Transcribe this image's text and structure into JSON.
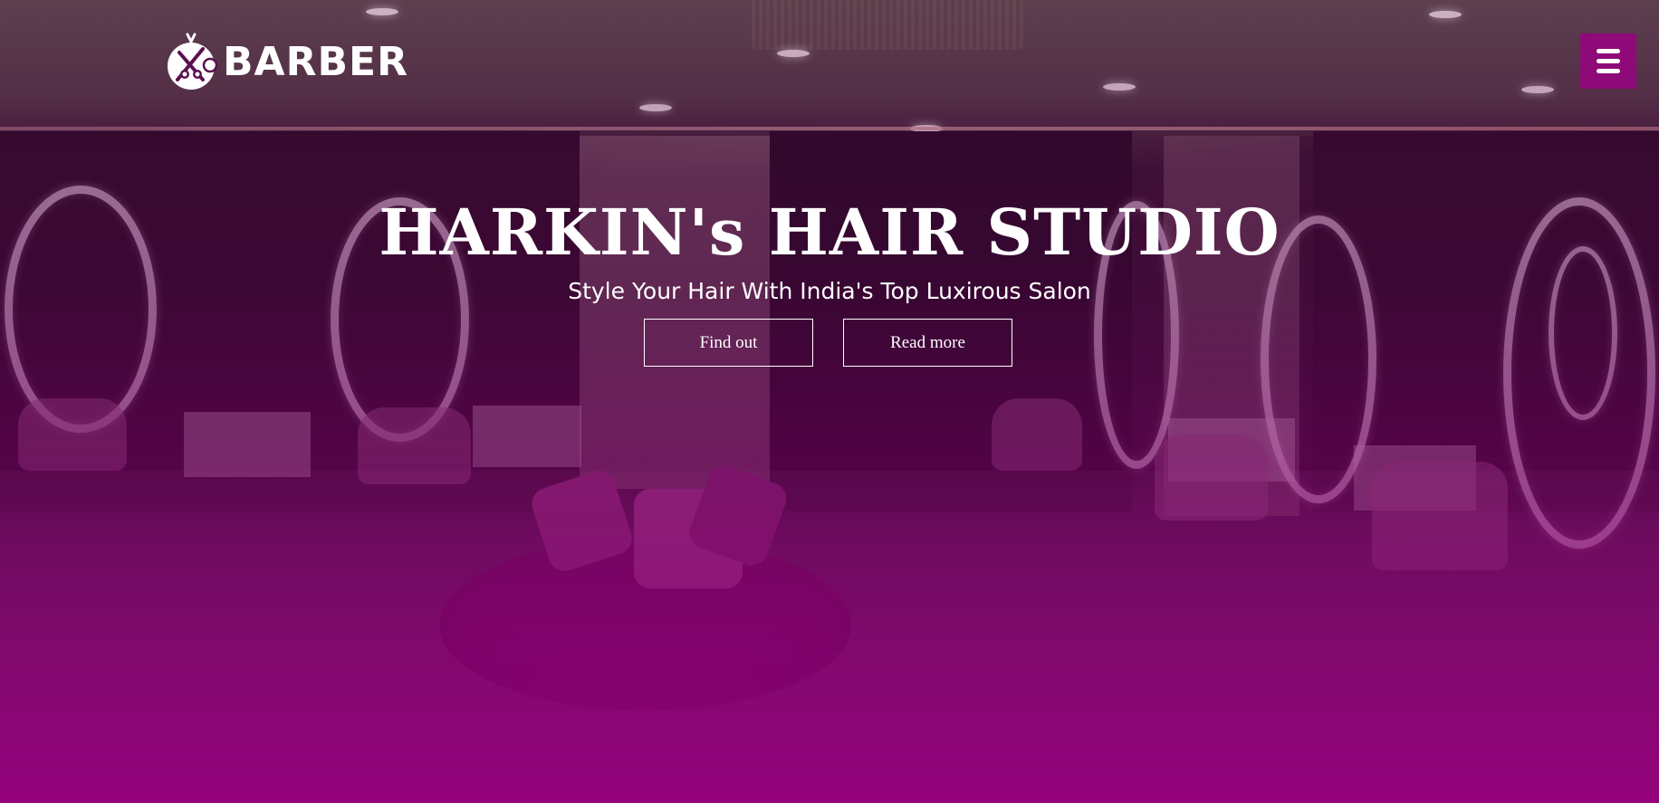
{
  "header": {
    "logo_text": "BARBER",
    "logo_icon": "scissors-comb-icon",
    "menu_icon": "hamburger-menu-icon"
  },
  "hero": {
    "title": "HARKIN's HAIR STUDIO",
    "subtitle": "Style Your Hair With India's Top Luxirous Salon",
    "buttons": [
      {
        "label": "Find out"
      },
      {
        "label": "Read more"
      }
    ]
  },
  "colors": {
    "accent": "#8e0a78",
    "overlay_bottom": "#96007d",
    "text": "#ffffff"
  }
}
